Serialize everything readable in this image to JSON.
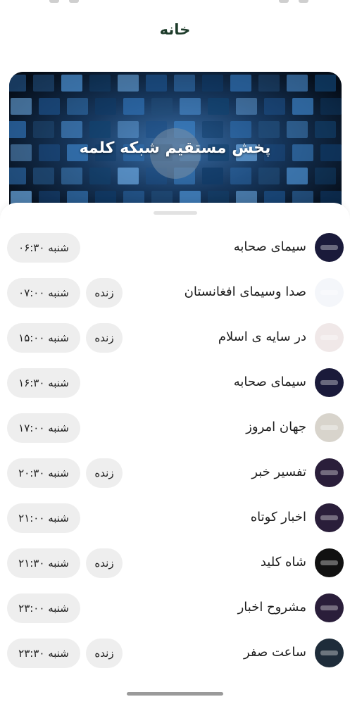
{
  "header": {
    "title": "خانه"
  },
  "banner": {
    "title": "پخش مستقیم شبکه کلمه"
  },
  "schedule": [
    {
      "name": "سیمای صحابه",
      "time": "شنبه ۰۶:۳۰",
      "live": "",
      "thumb": "sima-sahaba-logo-icon",
      "color": "#1a1a3a"
    },
    {
      "name": "صدا وسیمای افغانستان",
      "time": "شنبه ۰۷:۰۰",
      "live": "زنده",
      "thumb": "afghanistan-broadcast-logo-icon",
      "color": "#f4f6fa"
    },
    {
      "name": "در سایه ی اسلام",
      "time": "شنبه ۱۵:۰۰",
      "live": "زنده",
      "thumb": "shade-of-islam-logo-icon",
      "color": "#f0e8e8"
    },
    {
      "name": "سیمای صحابه",
      "time": "شنبه ۱۶:۳۰",
      "live": "",
      "thumb": "sima-sahaba-logo-icon",
      "color": "#1a1a3a"
    },
    {
      "name": "جهان امروز",
      "time": "شنبه ۱۷:۰۰",
      "live": "",
      "thumb": "world-today-logo-icon",
      "color": "#d8d4cc"
    },
    {
      "name": "تفسیر خبر",
      "time": "شنبه ۲۰:۳۰",
      "live": "زنده",
      "thumb": "news-commentary-logo-icon",
      "color": "#2a1e3a"
    },
    {
      "name": "اخبار کوتاه",
      "time": "شنبه ۲۱:۰۰",
      "live": "",
      "thumb": "short-news-logo-icon",
      "color": "#2a1e3a"
    },
    {
      "name": "شاه کلید",
      "time": "شنبه ۲۱:۳۰",
      "live": "زنده",
      "thumb": "master-key-logo-icon",
      "color": "#111111"
    },
    {
      "name": "مشروح اخبار",
      "time": "شنبه ۲۳:۰۰",
      "live": "",
      "thumb": "detailed-news-logo-icon",
      "color": "#2a1e3a"
    },
    {
      "name": "ساعت صفر",
      "time": "شنبه ۲۳:۳۰",
      "live": "زنده",
      "thumb": "zero-hour-logo-icon",
      "color": "#1e2c3a"
    }
  ]
}
